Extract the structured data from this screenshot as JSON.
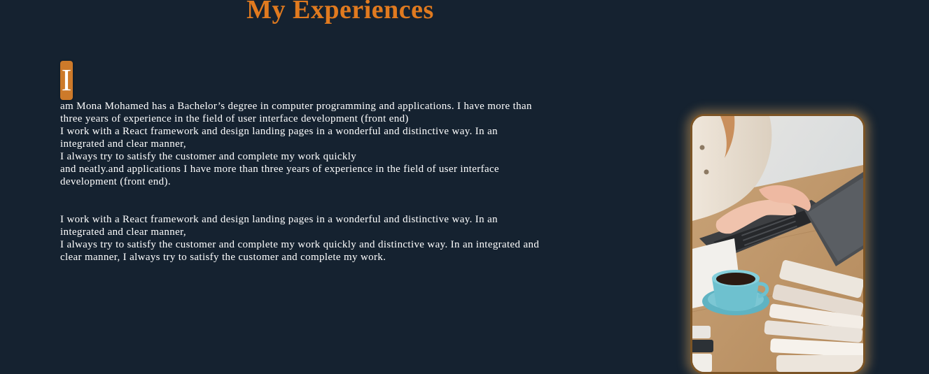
{
  "section": {
    "title": "My Experiences"
  },
  "intro": {
    "dropcap": "I",
    "lines": [
      "am Mona Mohamed has a Bachelor’s degree in computer programming and applications. I have more than",
      "three years of experience in the field of user interface development (front end)",
      "I work with a React framework and design landing pages in a wonderful and distinctive way. In an",
      "integrated and clear manner,",
      "I always try to satisfy the customer and complete my work quickly",
      "and neatly.and applications I have more than three years of experience in the field of user interface",
      "development (front end)."
    ]
  },
  "second_paragraph": {
    "lines": [
      "I work with a React framework and design landing pages in a wonderful and distinctive way. In an",
      "integrated and clear manner,",
      "I always try to satisfy the customer and complete my work quickly and distinctive way. In an integrated and",
      "clear manner, I always try to satisfy the customer and complete my work."
    ]
  },
  "colors": {
    "background": "#152230",
    "accent": "#e07a1f",
    "dropcap_bg": "#cd7a2a",
    "photo_border": "#7b5426"
  }
}
